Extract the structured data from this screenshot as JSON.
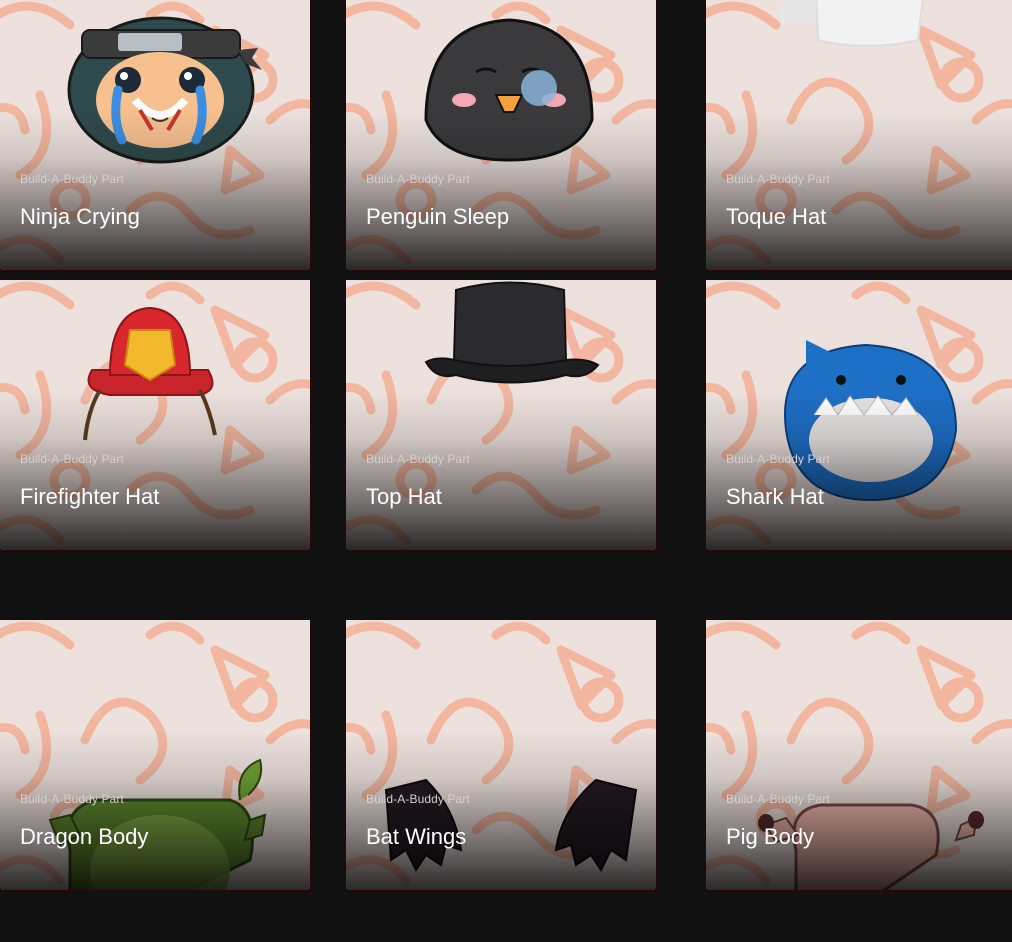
{
  "cards": [
    {
      "subtitle": "Build-A-Buddy Part",
      "title": "Ninja Crying",
      "icon": "ninja-crying-icon"
    },
    {
      "subtitle": "Build-A-Buddy Part",
      "title": "Penguin Sleep",
      "icon": "penguin-sleep-icon"
    },
    {
      "subtitle": "Build-A-Buddy Part",
      "title": "Toque Hat",
      "icon": "toque-hat-icon"
    },
    {
      "subtitle": "Build-A-Buddy Part",
      "title": "Firefighter Hat",
      "icon": "firefighter-hat-icon"
    },
    {
      "subtitle": "Build-A-Buddy Part",
      "title": "Top Hat",
      "icon": "top-hat-icon"
    },
    {
      "subtitle": "Build-A-Buddy Part",
      "title": "Shark Hat",
      "icon": "shark-hat-icon"
    },
    {
      "subtitle": "Build-A-Buddy Part",
      "title": "Dragon Body",
      "icon": "dragon-body-icon"
    },
    {
      "subtitle": "Build-A-Buddy Part",
      "title": "Bat Wings",
      "icon": "bat-wings-icon"
    },
    {
      "subtitle": "Build-A-Buddy Part",
      "title": "Pig Body",
      "icon": "pig-body-icon"
    }
  ],
  "colors": {
    "card_bg": "#ece1dd",
    "pattern": "#f4a487",
    "page_bg": "#111111"
  }
}
